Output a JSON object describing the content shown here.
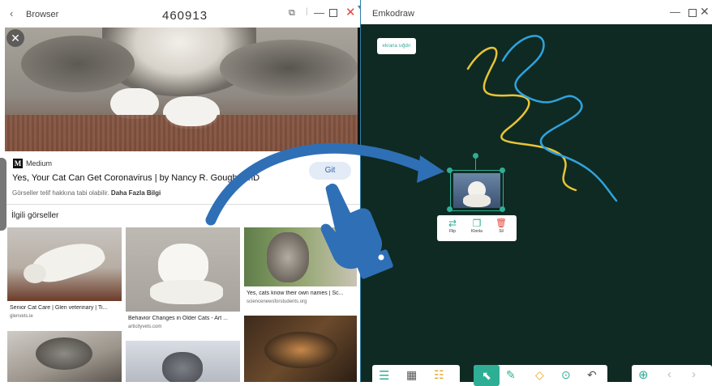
{
  "browser": {
    "title": "Browser",
    "overlay_number": "460913",
    "source_name": "Medium",
    "result_title": "Yes, Your Cat Can Get Coronavirus | by Nancy R. Gough, PhD | T...",
    "go_button": "Git",
    "copyright_text": "Görseller telif hakkına tabi olabilir.",
    "more_info": "Daha Fazla Bilgi",
    "related_heading": "İlgili görseller",
    "images": [
      {
        "caption": "Senior Cat Care | Glen veterinary | Ti...",
        "source": "glenvets.ie"
      },
      {
        "caption": "Behavior Changes in Older Cats - Art ...",
        "source": "articityvets.com"
      },
      {
        "caption": "Yes, cats know their own names | Sc...",
        "source": "sciencenewsforstudents.org"
      }
    ]
  },
  "emkodraw": {
    "title": "Emkodraw",
    "fit_screen_button": "ekrana sığdır",
    "context_menu": {
      "flip": "Flip",
      "clone": "Klonla",
      "delete": "Sil"
    }
  },
  "colors": {
    "board_bg": "#0f2a22",
    "accent_teal": "#2fae96",
    "stroke_yellow": "#e7c437",
    "stroke_blue": "#2ea3de",
    "arrow_blue": "#2f6fb6",
    "close_red": "#e0463c"
  },
  "icons": [
    "chevron-left-icon",
    "copy-icon",
    "minimize-icon",
    "maximize-icon",
    "close-icon",
    "hand-pointer-icon",
    "curved-arrow-icon",
    "menu-icon",
    "grid-icon",
    "list-icon",
    "cursor-icon",
    "pen-icon",
    "eraser-icon",
    "more-icon",
    "undo-icon",
    "add-icon",
    "chevron-right-icon"
  ]
}
